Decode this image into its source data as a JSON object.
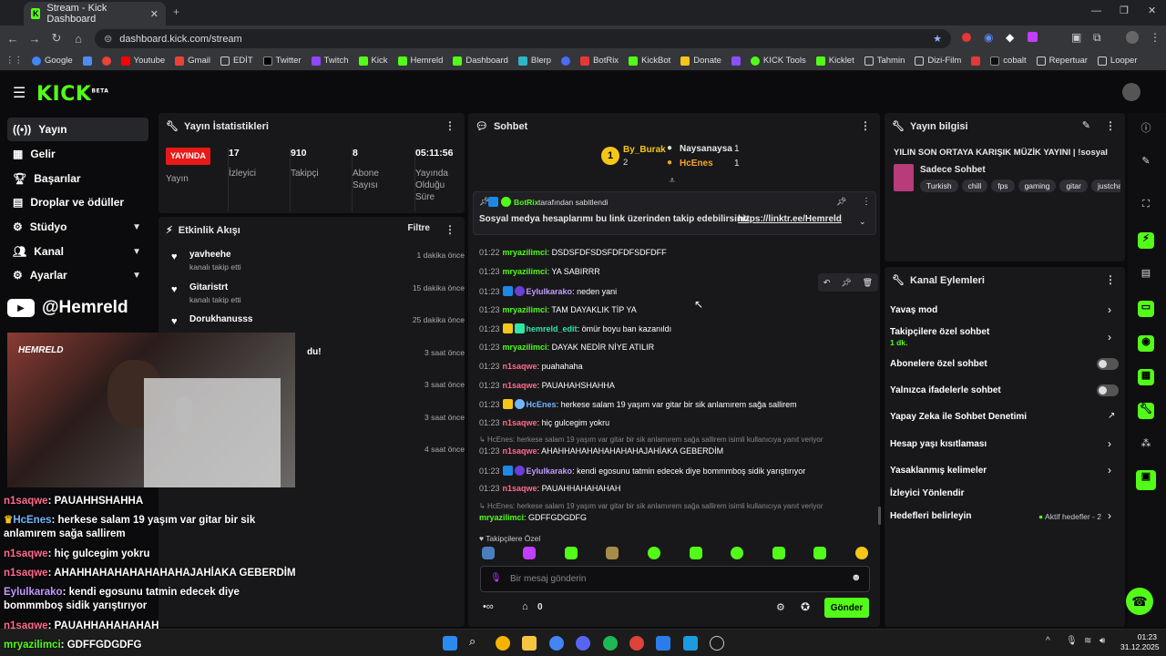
{
  "browser": {
    "tab_title": "Stream - Kick Dashboard",
    "url": "dashboard.kick.com/stream",
    "bookmarks": [
      "Google",
      "Youtube",
      "Gmail",
      "EDİT",
      "Twitter",
      "Twitch",
      "Kick",
      "Hemreld",
      "Dashboard",
      "Blerp",
      "BotRix",
      "KickBot",
      "Donate",
      "KICK Tools",
      "Kicklet",
      "Tahmin",
      "Dizi-Film",
      "cobalt",
      "Repertuar",
      "Looper"
    ]
  },
  "app": {
    "logo": "KICK",
    "logo_sup": "BETA"
  },
  "sidebar": {
    "items": [
      {
        "label": "Yayın",
        "icon": "broadcast-icon"
      },
      {
        "label": "Gelir",
        "icon": "grid-icon"
      },
      {
        "label": "Başarılar",
        "icon": "trophy-icon"
      },
      {
        "label": "Droplar ve ödüller",
        "icon": "gift-icon"
      },
      {
        "label": "Stüdyo",
        "icon": "gear-icon"
      },
      {
        "label": "Kanal",
        "icon": "users-icon"
      },
      {
        "label": "Ayarlar",
        "icon": "settings-icon"
      }
    ],
    "channel_handle": "@Hemreld"
  },
  "stats": {
    "title": "Yayın İstatistikleri",
    "live_badge": "YAYINDA",
    "live_label": "Yayın",
    "viewers_value": "17",
    "viewers_label": "İzleyici",
    "followers_value": "910",
    "followers_label": "Takipçi",
    "subs_value": "8",
    "subs_label": "Abone Sayısı",
    "uptime_value": "05:11:56",
    "uptime_label": "Yayında Olduğu Süre"
  },
  "activity": {
    "title": "Etkinlik Akışı",
    "filter": "Filtre",
    "items": [
      {
        "name": "yavheehe",
        "sub": "kanalı takip etti",
        "time": "1 dakika önce"
      },
      {
        "name": "Gitaristrt",
        "sub": "kanalı takip etti",
        "time": "15 dakika önce"
      },
      {
        "name": "Dorukhanusss",
        "sub": "",
        "time": "25 dakika önce"
      },
      {
        "name": "du!",
        "sub": "",
        "time": "3 saat önce"
      },
      {
        "name": "",
        "sub": "",
        "time": "3 saat önce"
      },
      {
        "name": "",
        "sub": "",
        "time": "3 saat önce"
      },
      {
        "name": "",
        "sub": "",
        "time": "4 saat önce"
      }
    ]
  },
  "chat": {
    "title": "Sohbet",
    "leader": {
      "rank": "1",
      "name": "By_Burak",
      "count": "2"
    },
    "top2": {
      "name": "Naysanaysa",
      "count": "1"
    },
    "top3": {
      "name": "HcEnes",
      "count": "1"
    },
    "pinned_by": "BotRix",
    "pinned_suffix": "tarafından sabitlendi",
    "pinned_text": "Sosyal medya hesaplarımı bu link üzerinden takip edebilirsiniz.",
    "pinned_link": "https://linktr.ee/Hemreld",
    "messages": [
      {
        "time": "01:22",
        "user": "mryazilimci",
        "text": "DSDSFDFSDSFDFDFSDFDFF",
        "color": "#53fc18"
      },
      {
        "time": "01:23",
        "user": "mryazilimci",
        "text": "YA SABIRRR",
        "color": "#53fc18"
      },
      {
        "time": "01:23",
        "user": "Eylulkarako",
        "text": "neden yani",
        "color": "#c39bff"
      },
      {
        "time": "01:23",
        "user": "mryazilimci",
        "text": "TAM DAYAKLIK TİP YA",
        "color": "#53fc18"
      },
      {
        "time": "01:23",
        "user": "hemreld_edit",
        "text": "ömür boyu ban kazanıldı",
        "color": "#2ee6a8"
      },
      {
        "time": "01:23",
        "user": "mryazilimci",
        "text": "DAYAK NEDİR NİYE ATILIR",
        "color": "#53fc18"
      },
      {
        "time": "01:23",
        "user": "n1saqwe",
        "text": "puahahaha",
        "color": "#ff6b8b"
      },
      {
        "time": "01:23",
        "user": "n1saqwe",
        "text": "PAUAHAHSHAHHA",
        "color": "#ff6b8b"
      },
      {
        "time": "01:23",
        "user": "HcEnes",
        "text": "herkese salam 19 yaşım var gitar bir sik anlamırem sağa sallirem",
        "color": "#6fb6ff"
      },
      {
        "time": "01:23",
        "user": "n1saqwe",
        "text": "hiç gulcegim yokru",
        "color": "#ff6b8b"
      },
      {
        "reply": "HcEnes: herkese salam 19 yaşım var gitar bir sik anlamırem sağa sallirem isimli kullanıcıya yanıt veriyor"
      },
      {
        "time": "01:23",
        "user": "n1saqwe",
        "text": "AHAHHAHAHAHAHAHAHAJAHİAKA GEBERDİM",
        "color": "#ff6b8b"
      },
      {
        "time": "01:23",
        "user": "Eylulkarako",
        "text": "kendi egosunu tatmin edecek diye bommmboş sidik yarıştırıyor",
        "color": "#c39bff"
      },
      {
        "time": "01:23",
        "user": "n1saqwe",
        "text": "PAUAHHAHAHAHAH",
        "color": "#ff6b8b"
      },
      {
        "reply": "HcEnes: herkese salam 19 yaşım var gitar bir sik anlamırem sağa sallirem isimli kullanıcıya yanıt veriyor"
      },
      {
        "time": "01:23",
        "user": "mryazilimci",
        "text": "GDFFGDGDFG",
        "color": "#53fc18"
      }
    ],
    "emote_label": "Takipçilere Özel",
    "input_placeholder": "Bir mesaj gönderin",
    "points": "0",
    "send": "Gönder"
  },
  "stream_info": {
    "title": "Yayın bilgisi",
    "stream_title": "YILIN SON ORTAYA KARIŞIK MÜZİK YAYINI | !sosyal",
    "category": "Sadece Sohbet",
    "tags": [
      "Turkish",
      "chill",
      "fps",
      "gaming",
      "gitar",
      "justcha"
    ]
  },
  "channel_actions": {
    "title": "Kanal Eylemleri",
    "rows": [
      {
        "label": "Yavaş mod",
        "type": "chev"
      },
      {
        "label": "Takipçilere özel sohbet",
        "sub": "1 dk.",
        "type": "chev"
      },
      {
        "label": "Abonelere özel sohbet",
        "type": "toggle"
      },
      {
        "label": "Yalnızca ifadelerle sohbet",
        "type": "toggle"
      },
      {
        "label": "Yapay Zeka ile Sohbet Denetimi",
        "type": "ext"
      },
      {
        "label": "Hesap yaşı kısıtlaması",
        "type": "chev"
      },
      {
        "label": "Yasaklanmış kelimeler",
        "type": "chev"
      },
      {
        "label": "İzleyici Yönlendir",
        "type": "none"
      },
      {
        "label": "Hedefleri belirleyin",
        "type": "chev",
        "extra": "Aktif hedefler - 2"
      }
    ]
  },
  "overlay_chat": [
    {
      "user": "n1saqwe",
      "text": "PAUAHHSHAHHA",
      "color": "#ff6b8b"
    },
    {
      "user": "HcEnes",
      "text": "herkese salam 19 yaşım var gitar bir sik",
      "text2": "anlamırem sağa sallirem",
      "color": "#6fb6ff"
    },
    {
      "user": "n1saqwe",
      "text": "hiç gulcegim yokru",
      "color": "#ff6b8b"
    },
    {
      "user": "n1saqwe",
      "text": "AHAHHAHAHAHAHAHAHAJAHİAKA GEBERDİM",
      "color": "#ff6b8b"
    },
    {
      "user": "Eylulkarako",
      "text": "kendi egosunu tatmin edecek diye",
      "text2": "bommmboş sidik yarıştırıyor",
      "color": "#c39bff"
    },
    {
      "user": "n1saqwe",
      "text": "PAUAHHAHAHAHAH",
      "color": "#ff6b8b"
    },
    {
      "user": "mryazilimci",
      "text": "GDFFGDGDFG",
      "color": "#53fc18"
    }
  ],
  "cam_label": "HEMRELD",
  "taskbar": {
    "time": "01:23",
    "date": "31.12.2025"
  },
  "colors": {
    "accent": "#53fc18",
    "live": "#e91916",
    "panel": "#18181b"
  }
}
